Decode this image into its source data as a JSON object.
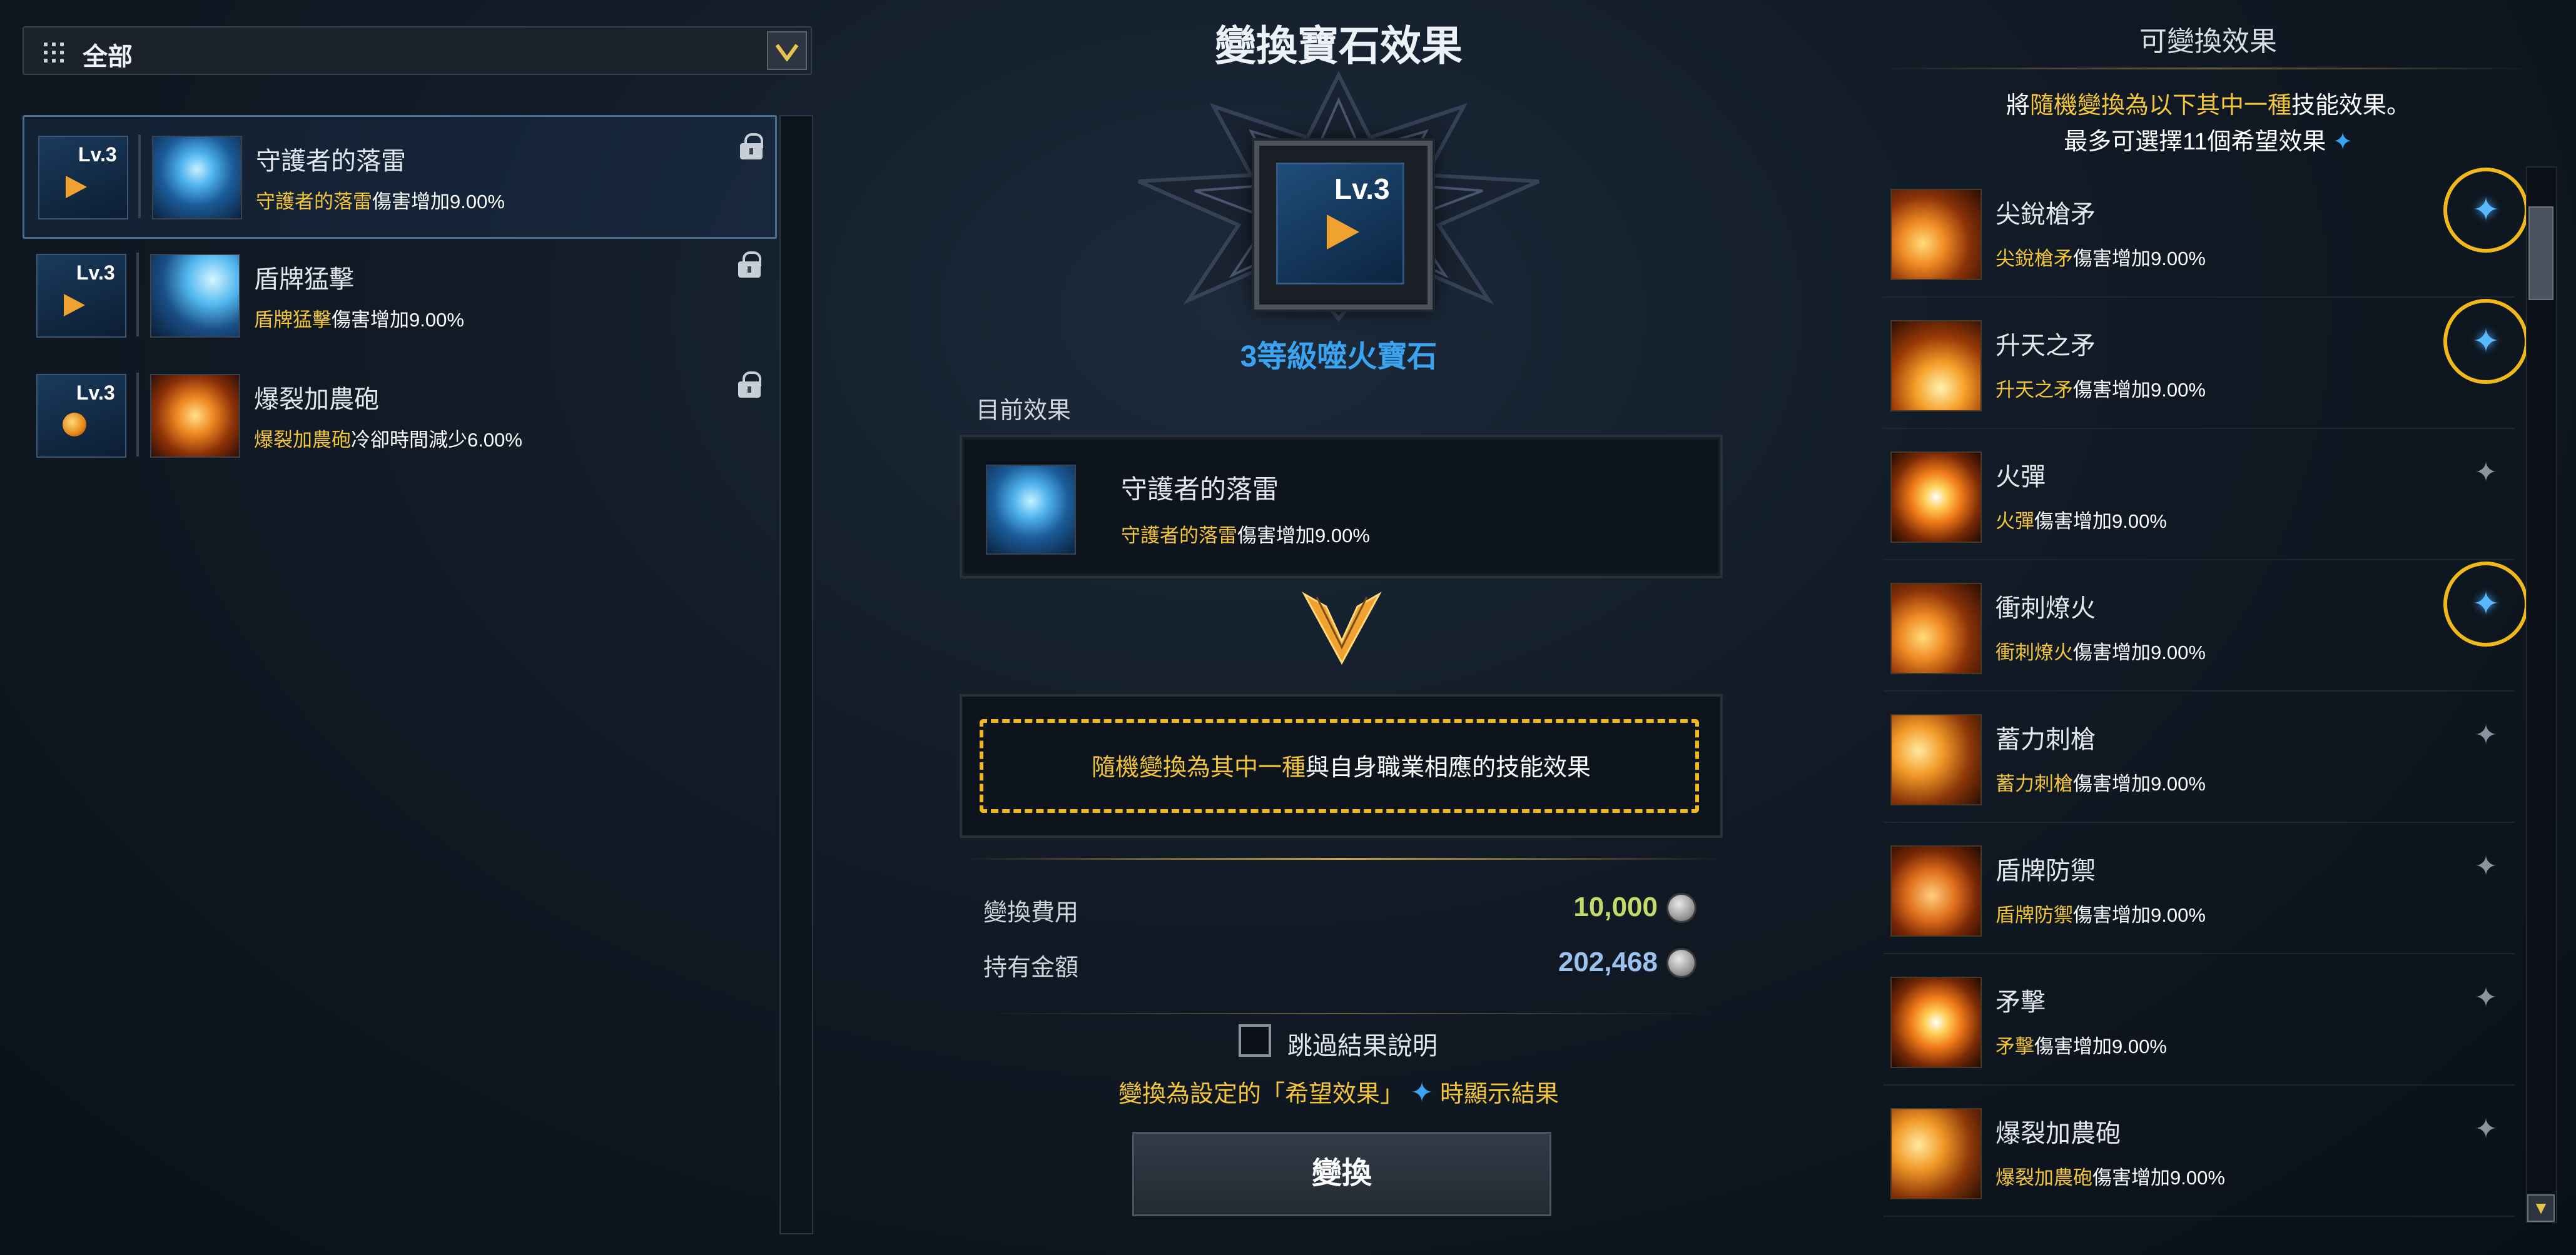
{
  "left_panel": {
    "filter": {
      "label": "全部",
      "icon": "grid-icon",
      "dropdown_icon": "chevron-down-icon"
    },
    "gems": [
      {
        "level": "Lv.3",
        "gem_type": "arrow",
        "skill_name": "守護者的落雷",
        "desc_highlight": "守護者的落雷",
        "desc_rest": "傷害增加9.00%",
        "icon_style": "blue",
        "selected": true,
        "lock_icon": "lock-icon"
      },
      {
        "level": "Lv.3",
        "gem_type": "arrow",
        "skill_name": "盾牌猛擊",
        "desc_highlight": "盾牌猛擊",
        "desc_rest": "傷害增加9.00%",
        "icon_style": "blue2",
        "selected": false,
        "lock_icon": "lock-icon"
      },
      {
        "level": "Lv.3",
        "gem_type": "orb",
        "skill_name": "爆裂加農砲",
        "desc_highlight": "爆裂加農砲",
        "desc_rest": "冷卻時間減少6.00%",
        "icon_style": "fire",
        "selected": false,
        "lock_icon": "lock-icon"
      }
    ]
  },
  "center": {
    "title": "變換寶石效果",
    "gem_level": "Lv.3",
    "gem_name": "3等級噬火寶石",
    "current_label": "目前效果",
    "current": {
      "name": "守護者的落雷",
      "desc_highlight": "守護者的落雷",
      "desc_rest": "傷害增加9.00%"
    },
    "random_highlight": "隨機變換為其中一種",
    "random_rest": "與自身職業相應的技能效果",
    "cost_label": "變換費用",
    "cost_value": "10,000",
    "cost_color": "#c3d96a",
    "held_label": "持有金額",
    "held_value": "202,468",
    "held_color": "#9cc3ee",
    "skip_label": "跳過結果說明",
    "skip_checked": false,
    "note_prefix": "變換為設定的「希望效果」",
    "note_star": "✦",
    "note_suffix": "時顯示結果",
    "button_label": "變換",
    "accent": "#f3c53c",
    "highlight_blue": "#3aa4f0"
  },
  "right_panel": {
    "title": "可變換效果",
    "intro_prefix": "將",
    "intro_highlight": "隨機變換為以下其中一種",
    "intro_suffix": "技能效果。",
    "intro_line2": "最多可選擇11個希望效果",
    "intro_star": "✦",
    "effects": [
      {
        "name": "尖銳槍矛",
        "desc_highlight": "尖銳槍矛",
        "desc_rest": "傷害增加9.00%",
        "star": "✦",
        "favored": true,
        "icon_style": "fire-a"
      },
      {
        "name": "升天之矛",
        "desc_highlight": "升天之矛",
        "desc_rest": "傷害增加9.00%",
        "star": "✦",
        "favored": true,
        "icon_style": "fire-b"
      },
      {
        "name": "火彈",
        "desc_highlight": "火彈",
        "desc_rest": "傷害增加9.00%",
        "star": "✦",
        "favored": false,
        "icon_style": "fire-c"
      },
      {
        "name": "衝刺燎火",
        "desc_highlight": "衝刺燎火",
        "desc_rest": "傷害增加9.00%",
        "star": "✦",
        "favored": true,
        "icon_style": "fire-a"
      },
      {
        "name": "蓄力刺槍",
        "desc_highlight": "蓄力刺槍",
        "desc_rest": "傷害增加9.00%",
        "star": "✦",
        "favored": false,
        "icon_style": "fire-d"
      },
      {
        "name": "盾牌防禦",
        "desc_highlight": "盾牌防禦",
        "desc_rest": "傷害增加9.00%",
        "star": "✦",
        "favored": false,
        "icon_style": "fire-e"
      },
      {
        "name": "矛擊",
        "desc_highlight": "矛擊",
        "desc_rest": "傷害增加9.00%",
        "star": "✦",
        "favored": false,
        "icon_style": "fire-c"
      },
      {
        "name": "爆裂加農砲",
        "desc_highlight": "爆裂加農砲",
        "desc_rest": "傷害增加9.00%",
        "star": "✦",
        "favored": false,
        "icon_style": "fire-d"
      }
    ],
    "scroll_down_icon": "▼"
  }
}
